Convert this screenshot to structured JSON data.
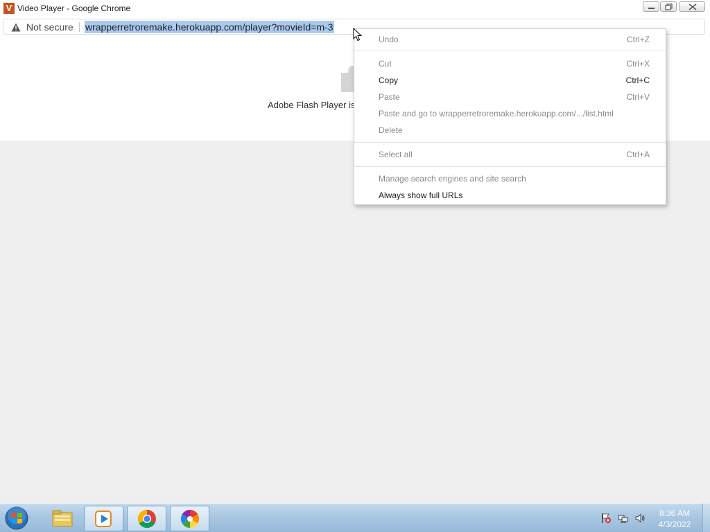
{
  "window": {
    "title": "Video Player - Google Chrome",
    "app_logo_letter": "V",
    "accent_color": "#c8531c"
  },
  "address_bar": {
    "security_label": "Not secure",
    "url": "wrapperretroremake.herokuapp.com/player?movieId=m-3",
    "selection_color": "#aac9ee"
  },
  "page": {
    "plugin_message": "Adobe Flash Player is blocked"
  },
  "context_menu": {
    "items": [
      {
        "label": "Undo",
        "shortcut": "Ctrl+Z",
        "enabled": false
      },
      {
        "label": "Cut",
        "shortcut": "Ctrl+X",
        "enabled": false
      },
      {
        "label": "Copy",
        "shortcut": "Ctrl+C",
        "enabled": true
      },
      {
        "label": "Paste",
        "shortcut": "Ctrl+V",
        "enabled": false
      },
      {
        "label": "Paste and go to wrapperretroremake.herokuapp.com/.../list.html",
        "shortcut": "",
        "enabled": false
      },
      {
        "label": "Delete",
        "shortcut": "",
        "enabled": false
      },
      {
        "label": "Select all",
        "shortcut": "Ctrl+A",
        "enabled": false
      },
      {
        "label": "Manage search engines and site search",
        "shortcut": "",
        "enabled": false
      },
      {
        "label": "Always show full URLs",
        "shortcut": "",
        "enabled": true
      }
    ]
  },
  "taskbar": {
    "pinned": [
      "windows-explorer-icon",
      "media-player-icon",
      "chrome-icon",
      "photo-viewer-icon"
    ],
    "clock_time": "8:36 AM",
    "clock_date": "4/3/2022"
  }
}
